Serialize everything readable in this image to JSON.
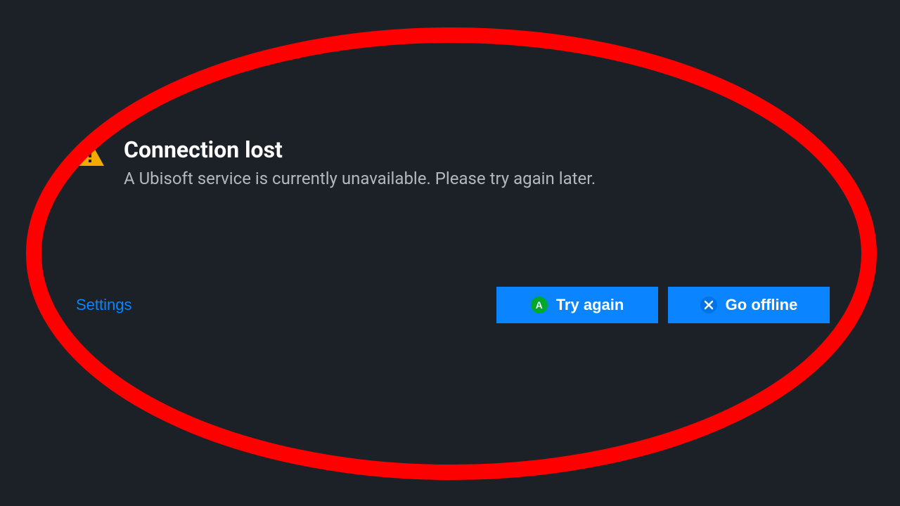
{
  "dialog": {
    "title": "Connection lost",
    "message": "A Ubisoft service is currently unavailable. Please try again later.",
    "settings_label": "Settings",
    "try_again_label": "Try again",
    "go_offline_label": "Go offline",
    "gamepad_a": "A",
    "gamepad_x": "X"
  },
  "colors": {
    "background": "#1b2126",
    "accent": "#0a84ff",
    "warning": "#f2a900",
    "highlight": "#ff0000"
  }
}
